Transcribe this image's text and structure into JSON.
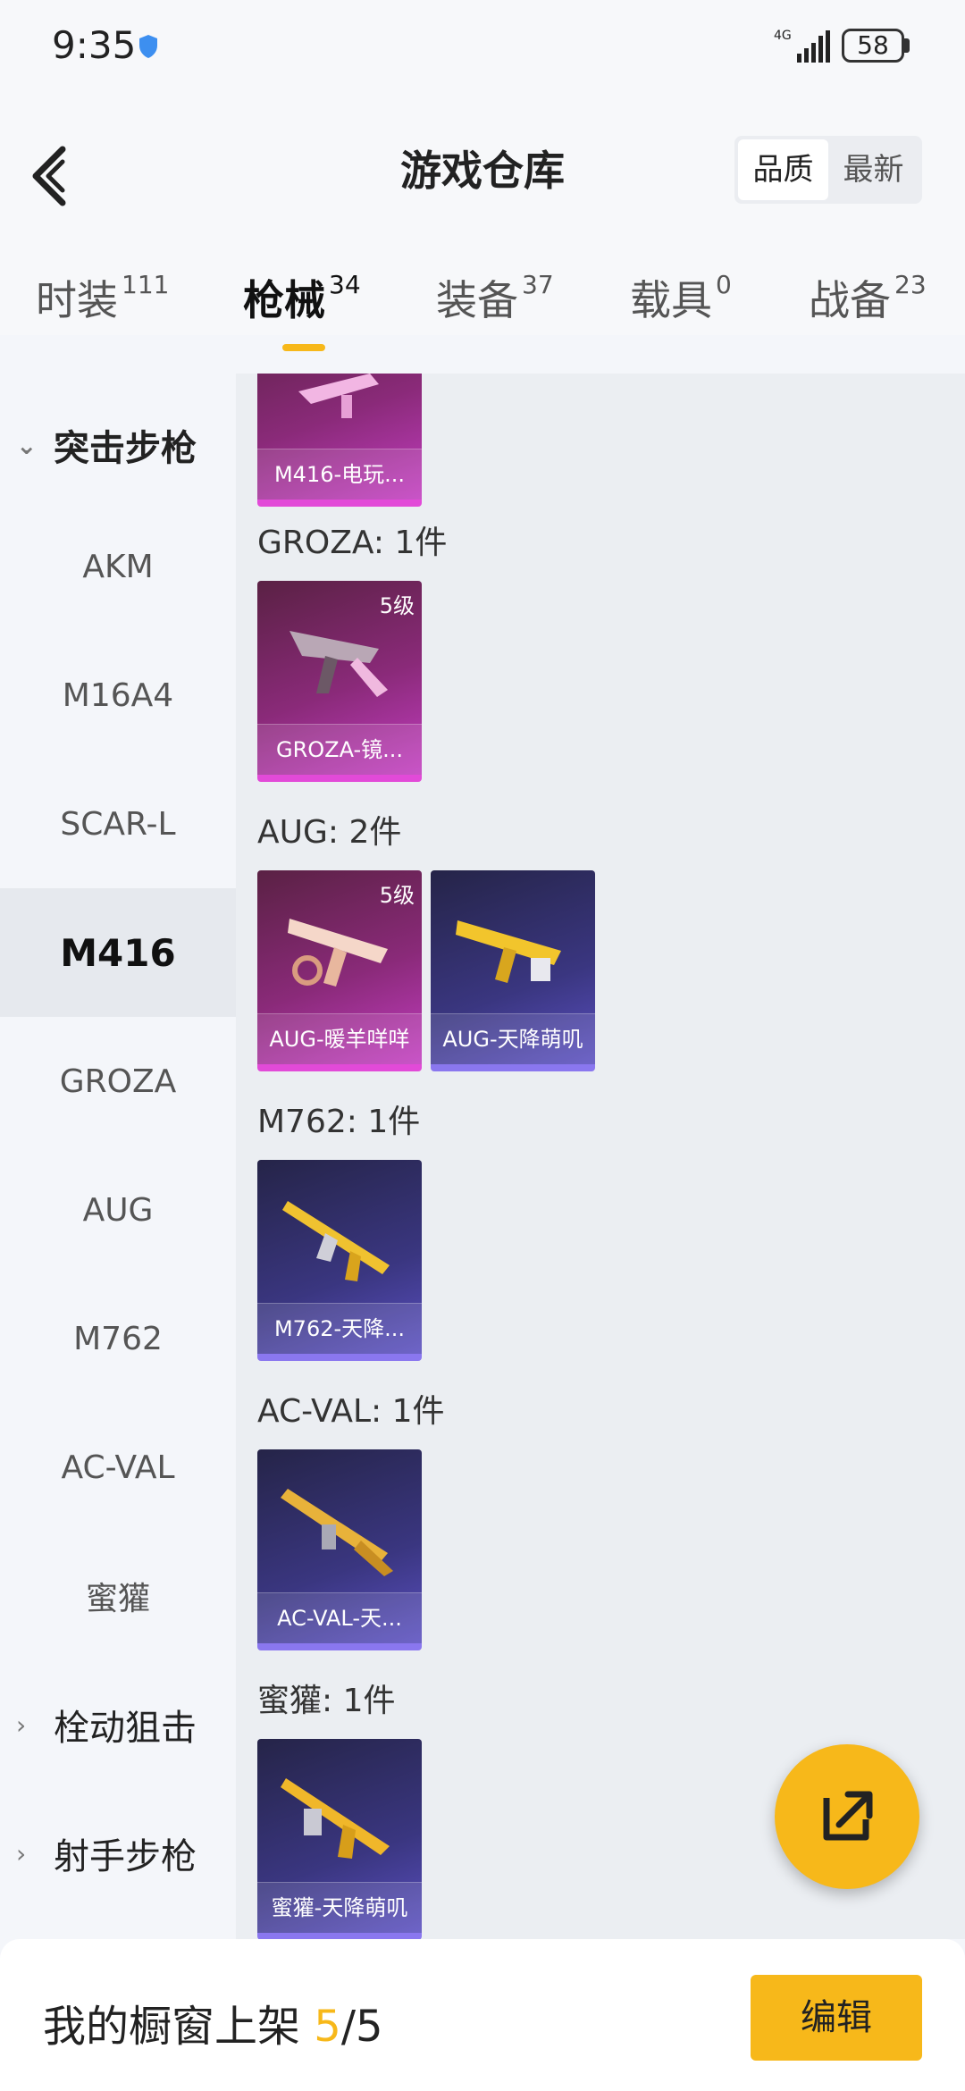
{
  "status": {
    "time": "9:35",
    "network": "4G",
    "battery": "58"
  },
  "header": {
    "title": "游戏仓库",
    "sort": [
      "品质",
      "最新"
    ]
  },
  "tabs": [
    {
      "label": "时装",
      "count": "111"
    },
    {
      "label": "枪械",
      "count": "34"
    },
    {
      "label": "装备",
      "count": "37"
    },
    {
      "label": "载具",
      "count": "0"
    },
    {
      "label": "战备",
      "count": "23"
    }
  ],
  "sidebar": {
    "group_open": "突击步枪",
    "items": [
      "AKM",
      "M16A4",
      "SCAR-L",
      "M416",
      "GROZA",
      "AUG",
      "M762",
      "AC-VAL",
      "蜜獾"
    ],
    "group_closed_1": "栓动狙击",
    "group_closed_2": "射手步枪"
  },
  "sections": {
    "m416_card": "M416-电玩...",
    "groza_title": "GROZA: 1件",
    "groza_card": {
      "name": "GROZA-镜...",
      "level": "5级"
    },
    "aug_title": "AUG: 2件",
    "aug_card1": {
      "name": "AUG-暖羊咩咩",
      "level": "5级"
    },
    "aug_card2": {
      "name": "AUG-天降萌叽"
    },
    "m762_title": "M762: 1件",
    "m762_card": "M762-天降...",
    "acval_title": "AC-VAL: 1件",
    "acval_card": "AC-VAL-天...",
    "honey_title": "蜜獾: 1件",
    "honey_card": "蜜獾-天降萌叽"
  },
  "bottom": {
    "showcase_label": "我的橱窗上架",
    "current": "5",
    "total": "/5",
    "edit": "编辑"
  },
  "colors": {
    "accent": "#f7b81a",
    "pink_card": "#8a2a79",
    "purple_card": "#3a3680"
  }
}
